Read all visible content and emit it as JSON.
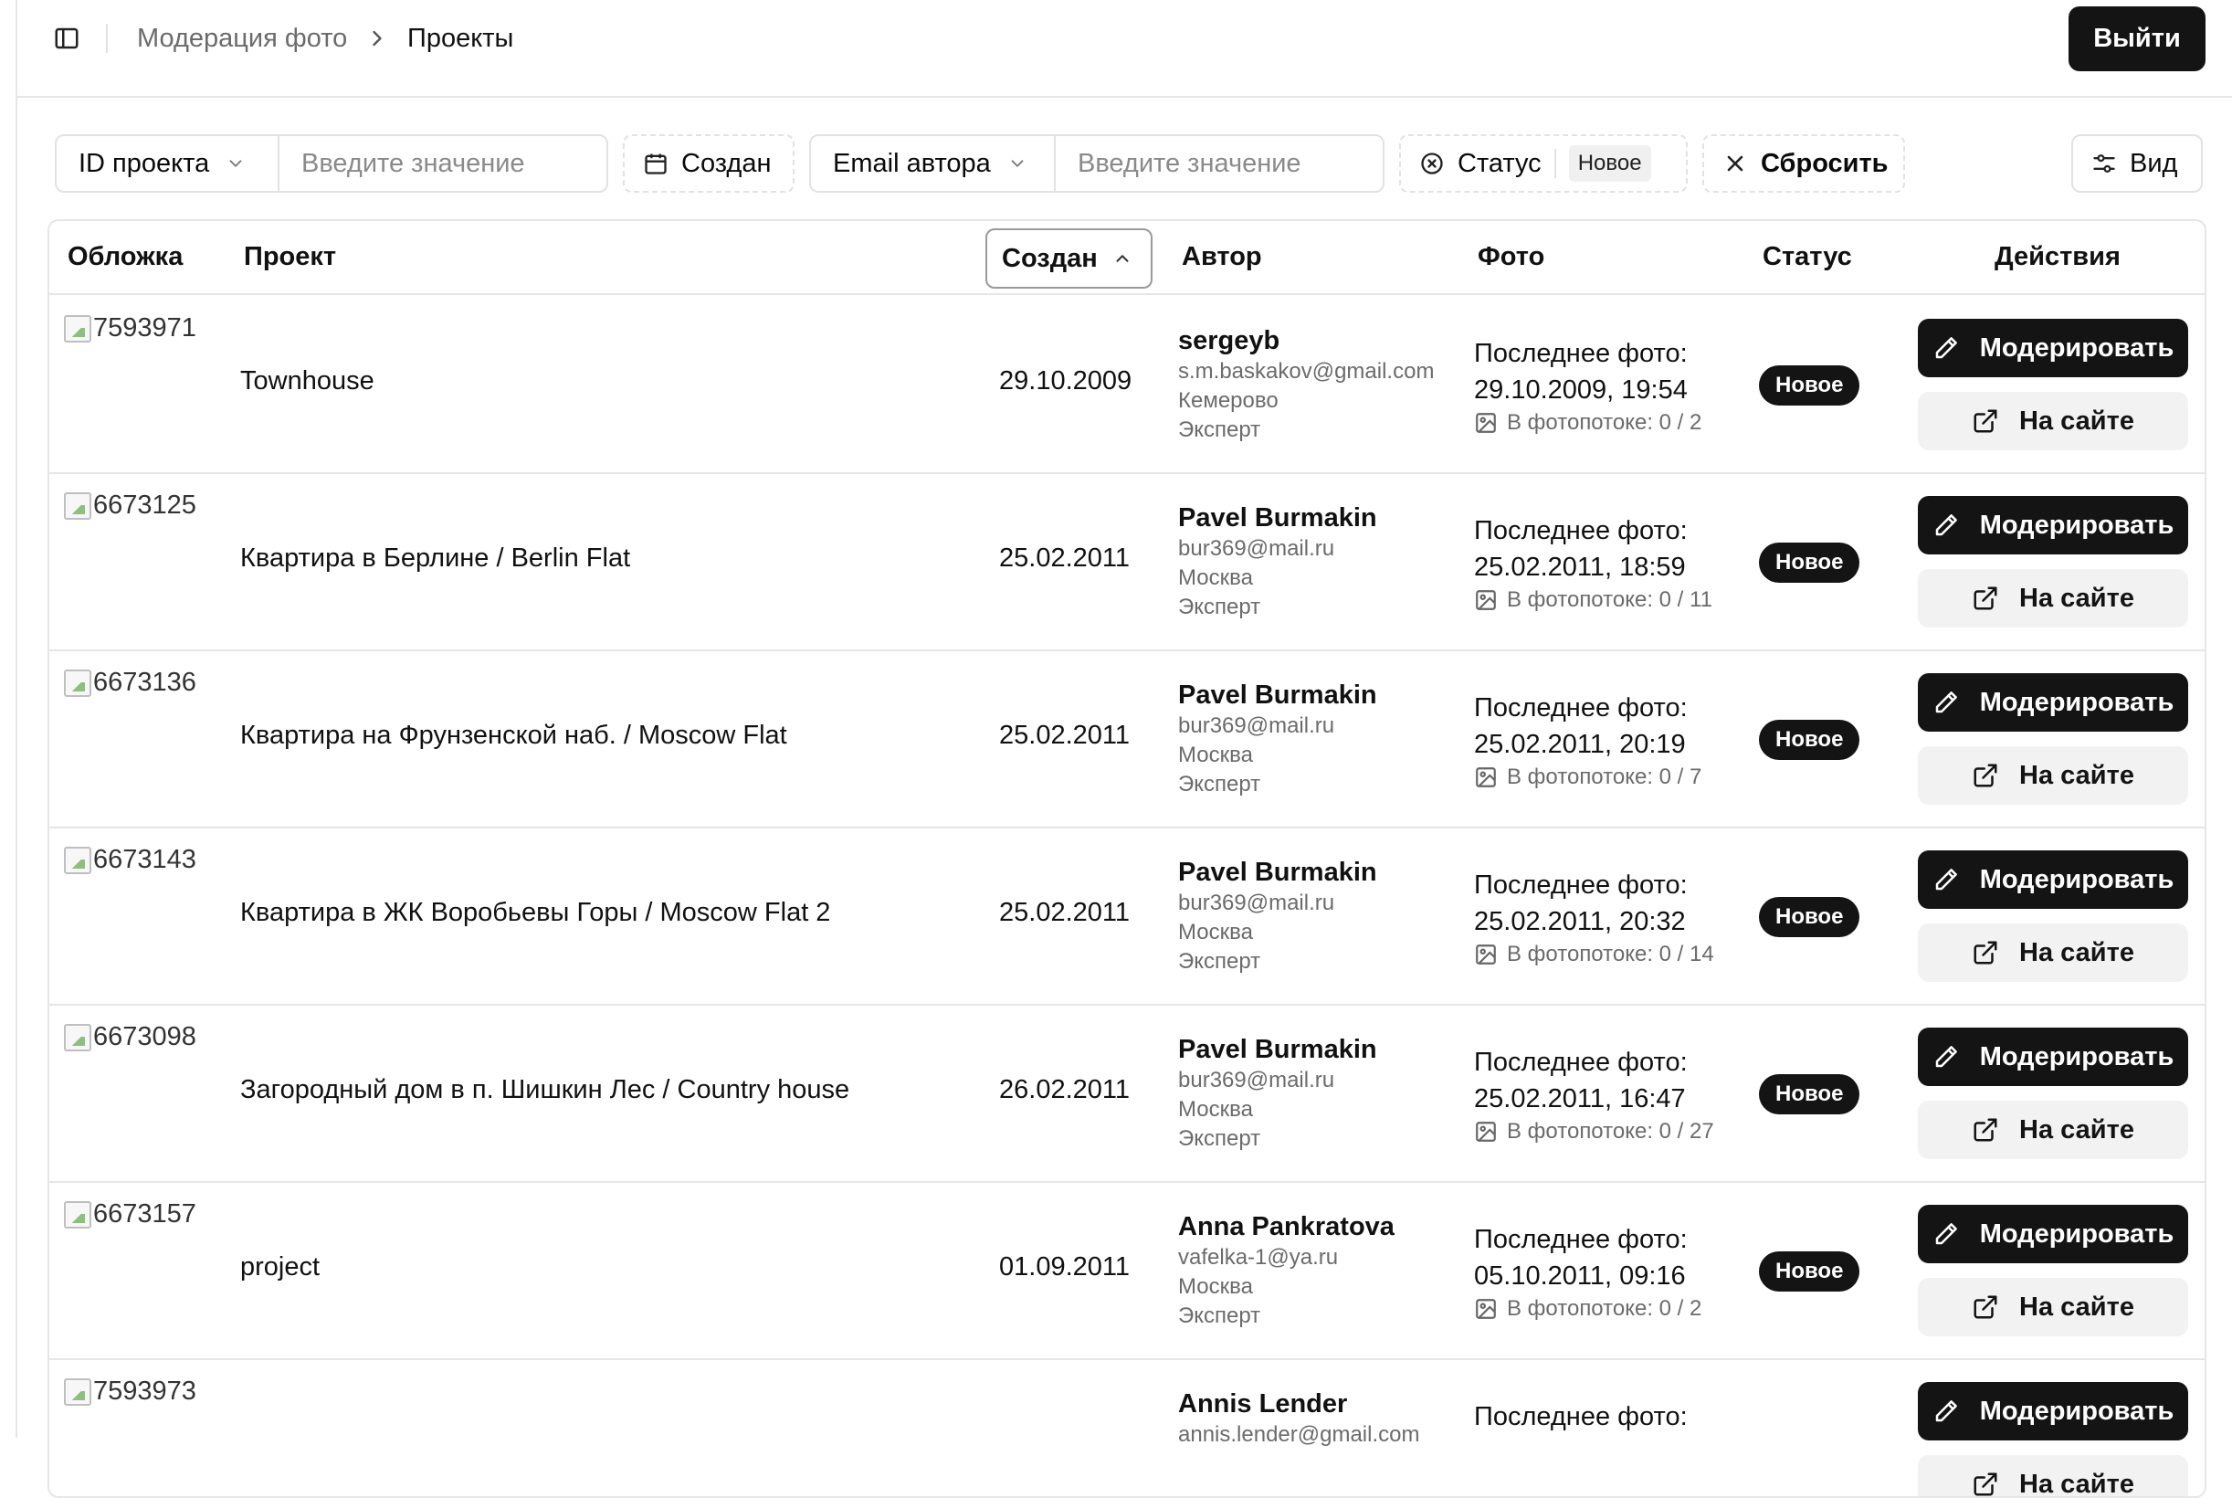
{
  "header": {
    "breadcrumb_parent": "Модерация фото",
    "breadcrumb_current": "Проекты",
    "logout_label": "Выйти"
  },
  "filters": {
    "project_id_select": "ID проекта",
    "project_id_placeholder": "Введите значение",
    "created_label": "Создан",
    "email_select": "Email автора",
    "email_placeholder": "Введите значение",
    "status_label": "Статус",
    "status_value": "Новое",
    "reset_label": "Сбросить",
    "view_label": "Вид"
  },
  "table": {
    "columns": {
      "cover": "Обложка",
      "project": "Проект",
      "created": "Создан",
      "author": "Автор",
      "photo": "Фото",
      "status": "Статус",
      "actions": "Действия"
    },
    "labels": {
      "last_photo": "Последнее фото:",
      "moderate": "Модерировать",
      "on_site": "На сайте"
    },
    "rows": [
      {
        "id": "7593971",
        "name": "Townhouse",
        "created": "29.10.2009",
        "author_name": "sergeyb",
        "author_email": "s.m.baskakov@gmail.com",
        "author_city": "Кемерово",
        "author_role": "Эксперт",
        "last_photo": "29.10.2009, 19:54",
        "stream": "В фотопотоке: 0 / 2",
        "status": "Новое"
      },
      {
        "id": "6673125",
        "name": "Квартира в Берлине / Berlin Flat",
        "created": "25.02.2011",
        "author_name": "Pavel Burmakin",
        "author_email": "bur369@mail.ru",
        "author_city": "Москва",
        "author_role": "Эксперт",
        "last_photo": "25.02.2011, 18:59",
        "stream": "В фотопотоке: 0 / 11",
        "status": "Новое"
      },
      {
        "id": "6673136",
        "name": "Квартира на Фрунзенской наб. / Moscow Flat",
        "created": "25.02.2011",
        "author_name": "Pavel Burmakin",
        "author_email": "bur369@mail.ru",
        "author_city": "Москва",
        "author_role": "Эксперт",
        "last_photo": "25.02.2011, 20:19",
        "stream": "В фотопотоке: 0 / 7",
        "status": "Новое"
      },
      {
        "id": "6673143",
        "name": "Квартира в ЖК Воробьевы Горы / Moscow Flat 2",
        "created": "25.02.2011",
        "author_name": "Pavel Burmakin",
        "author_email": "bur369@mail.ru",
        "author_city": "Москва",
        "author_role": "Эксперт",
        "last_photo": "25.02.2011, 20:32",
        "stream": "В фотопотоке: 0 / 14",
        "status": "Новое"
      },
      {
        "id": "6673098",
        "name": "Загородный дом в п. Шишкин Лес / Country house",
        "created": "26.02.2011",
        "author_name": "Pavel Burmakin",
        "author_email": "bur369@mail.ru",
        "author_city": "Москва",
        "author_role": "Эксперт",
        "last_photo": "25.02.2011, 16:47",
        "stream": "В фотопотоке: 0 / 27",
        "status": "Новое"
      },
      {
        "id": "6673157",
        "name": "project",
        "created": "01.09.2011",
        "author_name": "Anna Pankratova",
        "author_email": "vafelka-1@ya.ru",
        "author_city": "Москва",
        "author_role": "Эксперт",
        "last_photo": "05.10.2011, 09:16",
        "stream": "В фотопотоке: 0 / 2",
        "status": "Новое"
      },
      {
        "id": "7593973",
        "name": "",
        "created": "",
        "author_name": "Annis Lender",
        "author_email": "annis.lender@gmail.com",
        "author_city": "",
        "author_role": "",
        "last_photo": "",
        "stream": "",
        "status": ""
      }
    ]
  }
}
